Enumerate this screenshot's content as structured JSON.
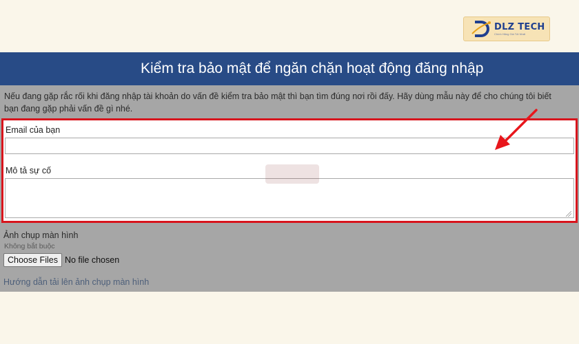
{
  "brand": {
    "name": "DLZ TECH",
    "tagline": "Chính Hãng Giá Tốt Nhất",
    "accent": "#1f3f8f"
  },
  "header": {
    "title": "Kiểm tra bảo mật để ngăn chặn hoạt động đăng nhập",
    "background": "#284b86"
  },
  "intro": {
    "line1": "Nếu đang gặp rắc rối khi đăng nhập tài khoản do vấn đề kiểm tra bảo mật thì bạn tìm đúng nơi rồi đấy. Hãy dùng mẫu này để cho chúng tôi biết",
    "line2": "bạn đang gặp phải vấn đề gì nhé."
  },
  "form": {
    "email_label": "Email của bạn",
    "email_value": "",
    "description_label": "Mô tả sự cố",
    "description_value": "",
    "highlight_color": "#d8141c"
  },
  "screenshot_section": {
    "label": "Ảnh chụp màn hình",
    "optional": "Không bắt buộc",
    "choose_button": "Choose Files",
    "file_status": "No file chosen",
    "guide_link": "Hướng dẫn tải lên ảnh chụp màn hình"
  },
  "annotation": {
    "arrow_color": "#e8161c"
  },
  "icons": [
    "logo-mark-icon",
    "resize-handle-icon",
    "watermark-icon",
    "arrow-icon"
  ]
}
